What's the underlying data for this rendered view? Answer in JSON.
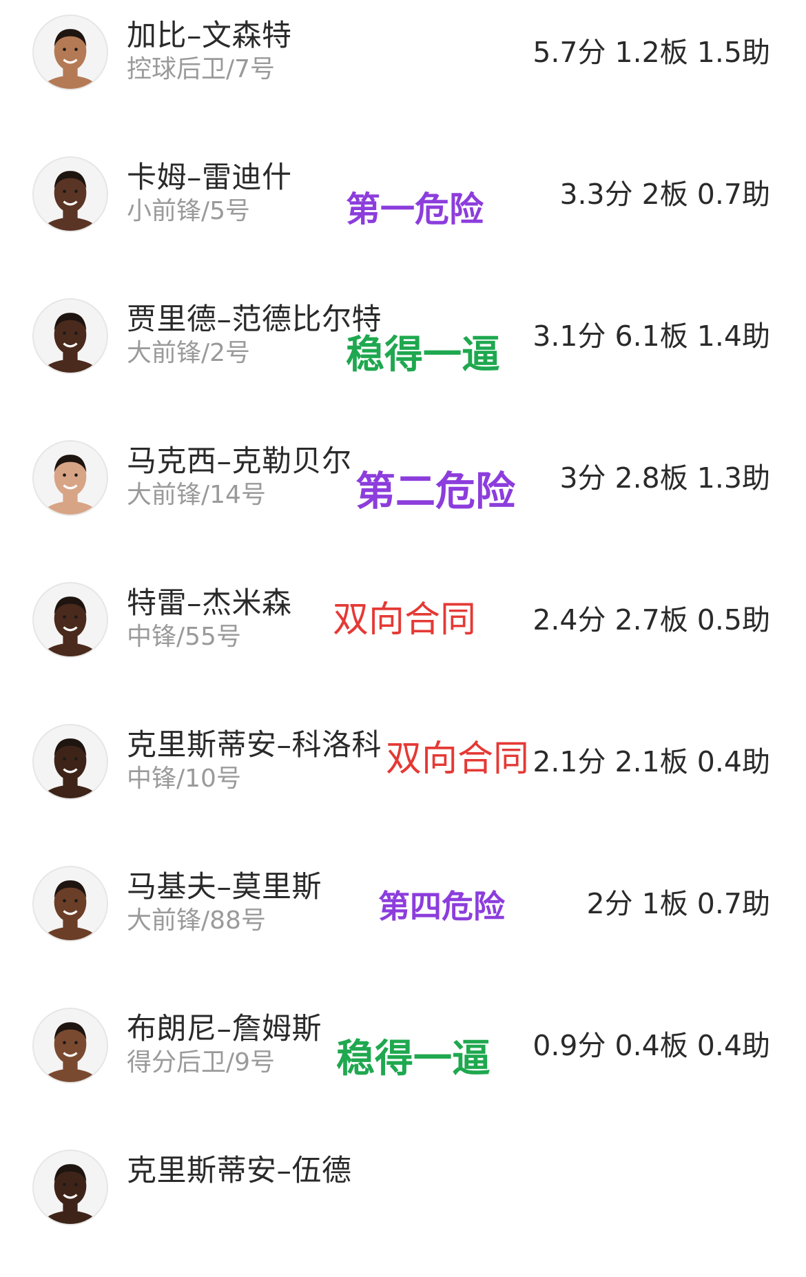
{
  "colors": {
    "danger_purple": "#8c3ddc",
    "stable_green": "#1fa84f",
    "two_way_red": "#e53935"
  },
  "players": [
    {
      "name": "加比–文森特",
      "position": "控球后卫/7号",
      "stats": "5.7分 1.2板 1.5助",
      "tag": "",
      "tag_color": "",
      "skin": "#b47a55",
      "avatar_icon": "player-headshot-icon"
    },
    {
      "name": "卡姆–雷迪什",
      "position": "小前锋/5号",
      "stats": "3.3分 2板 0.7助",
      "tag": "第一危险",
      "tag_color": "#8c3ddc",
      "skin": "#5a3424",
      "avatar_icon": "player-headshot-icon"
    },
    {
      "name": "贾里德–范德比尔特",
      "position": "大前锋/2号",
      "stats": "3.1分 6.1板 1.4助",
      "tag": "稳得一逼",
      "tag_color": "#1fa84f",
      "skin": "#4a2a1c",
      "avatar_icon": "player-headshot-icon"
    },
    {
      "name": "马克西–克勒贝尔",
      "position": "大前锋/14号",
      "stats": "3分 2.8板 1.3助",
      "tag": "第二危险",
      "tag_color": "#8c3ddc",
      "skin": "#d8a486",
      "avatar_icon": "player-headshot-icon"
    },
    {
      "name": "特雷–杰米森",
      "position": "中锋/55号",
      "stats": "2.4分 2.7板 0.5助",
      "tag": "双向合同",
      "tag_color": "#e53935",
      "skin": "#4a2a1c",
      "avatar_icon": "player-headshot-icon"
    },
    {
      "name": "克里斯蒂安–科洛科",
      "position": "中锋/10号",
      "stats": "2.1分 2.1板 0.4助",
      "tag": "双向合同",
      "tag_color": "#e53935",
      "skin": "#3e2418",
      "avatar_icon": "player-headshot-icon"
    },
    {
      "name": "马基夫–莫里斯",
      "position": "大前锋/88号",
      "stats": "2分 1板 0.7助",
      "tag": "第四危险",
      "tag_color": "#8c3ddc",
      "skin": "#6b3e28",
      "avatar_icon": "player-headshot-icon"
    },
    {
      "name": "布朗尼–詹姆斯",
      "position": "得分后卫/9号",
      "stats": "0.9分 0.4板 0.4助",
      "tag": "稳得一逼",
      "tag_color": "#1fa84f",
      "skin": "#7a4a30",
      "avatar_icon": "player-headshot-icon"
    },
    {
      "name": "克里斯蒂安–伍德",
      "position": "",
      "stats": "",
      "tag": "",
      "tag_color": "#8c3ddc",
      "skin": "#3e2418",
      "avatar_icon": "player-headshot-icon"
    }
  ]
}
